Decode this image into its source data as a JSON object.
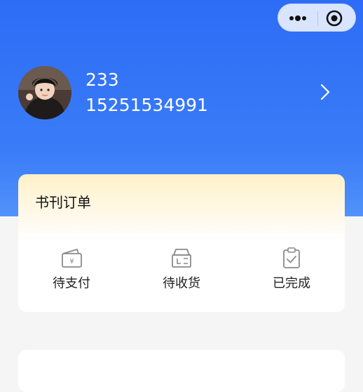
{
  "profile": {
    "username": "233",
    "phone": "15251534991"
  },
  "orders": {
    "title": "书刊订单",
    "items": [
      {
        "label": "待支付",
        "icon": "wallet-yen-icon"
      },
      {
        "label": "待收货",
        "icon": "package-box-icon"
      },
      {
        "label": "已完成",
        "icon": "clipboard-check-icon"
      }
    ]
  },
  "colors": {
    "header_blue": "#2d6cf6",
    "card_gold": "#fff1c8",
    "icon_gray": "#8a8a8a"
  }
}
